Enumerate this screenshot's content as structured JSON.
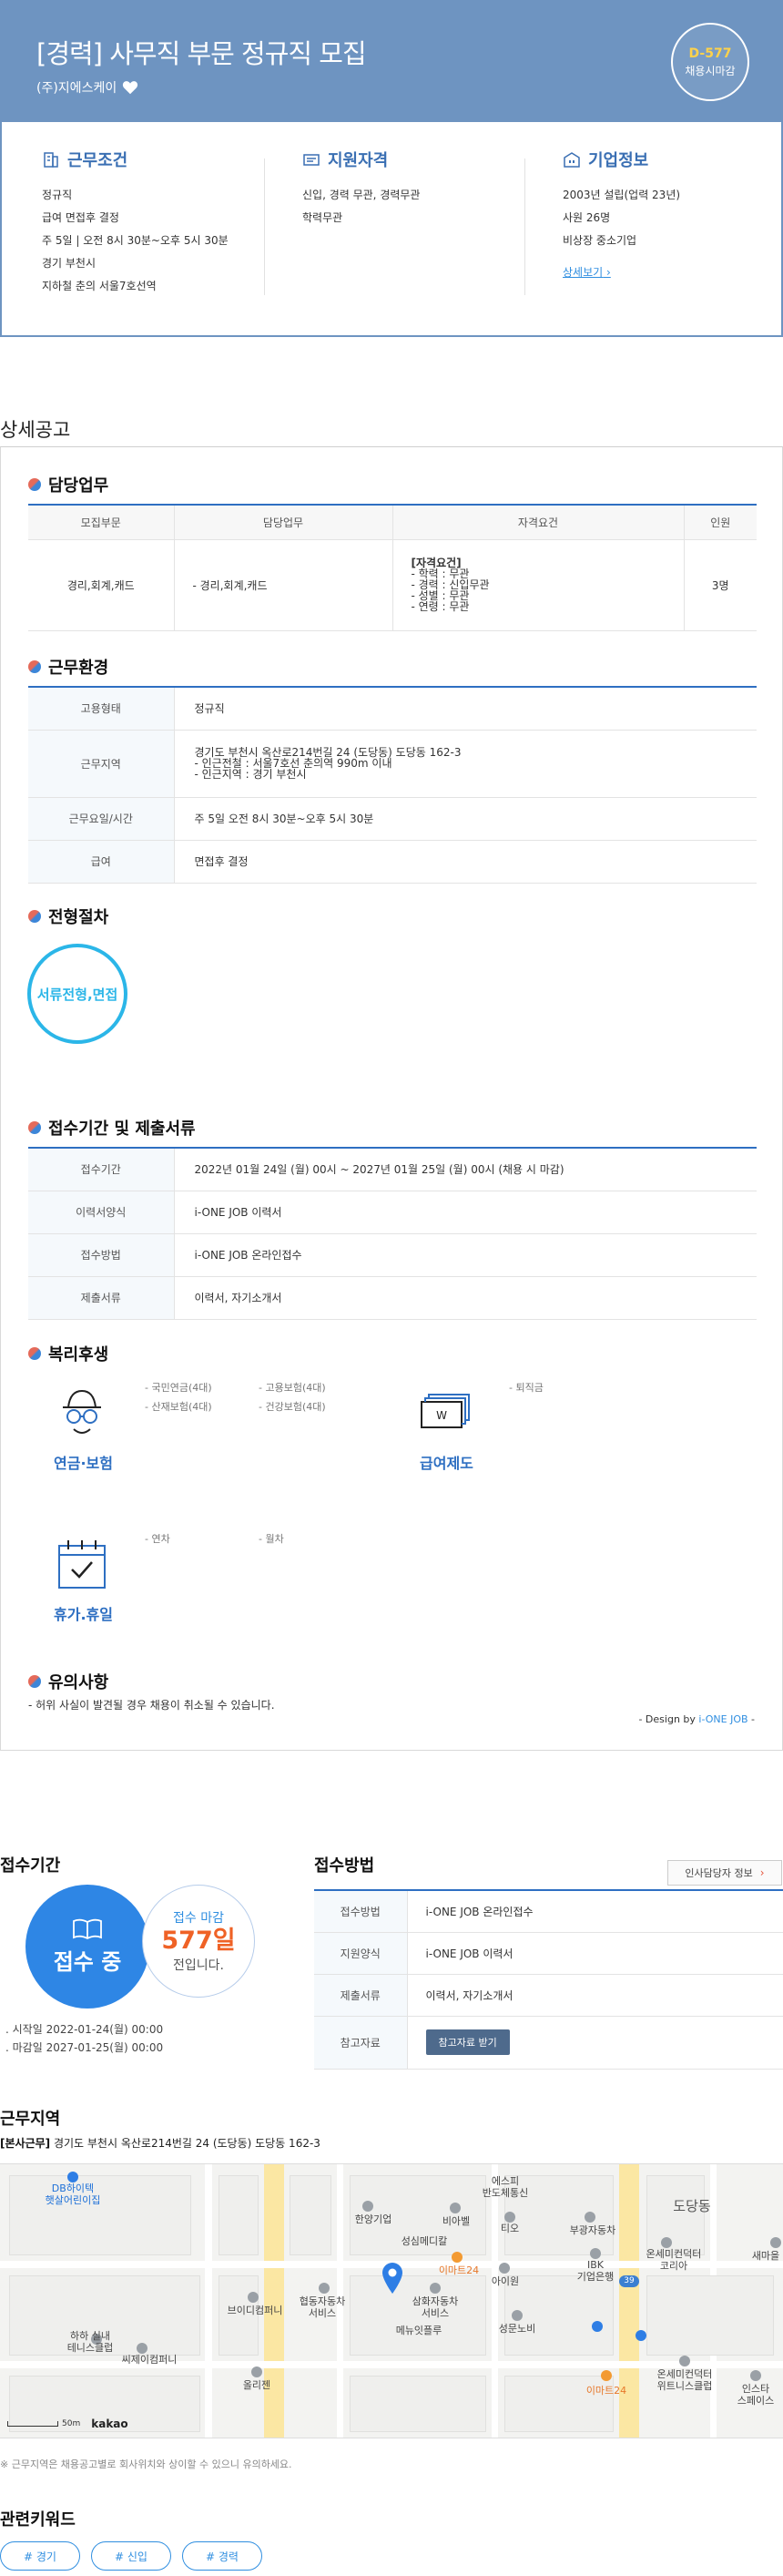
{
  "hero": {
    "title": "[경력] 사무직 부문 정규직 모집",
    "company": "(주)지에스케이",
    "dday": "D-577",
    "dday_label": "채용시마감"
  },
  "summary": {
    "work": {
      "title": "근무조건",
      "items": [
        "정규직",
        "급여 면접후 결정",
        "주 5일 | 오전 8시 30분~오후 5시 30분",
        "경기 부천시",
        "지하철 춘의 서울7호선역"
      ]
    },
    "qual": {
      "title": "지원자격",
      "items": [
        "신입, 경력 무관, 경력무관",
        "학력무관"
      ]
    },
    "corp": {
      "title": "기업정보",
      "items": [
        "2003년 설립(업력 23년)",
        "사원 26명",
        "비상장 중소기업"
      ],
      "link": "상세보기"
    }
  },
  "detail": {
    "title": "상세공고",
    "duty": {
      "title": "담당업무",
      "headers": [
        "모집부문",
        "담당업무",
        "자격요건",
        "인원"
      ],
      "row": {
        "dept": "경리,회계,캐드",
        "task": "- 경리,회계,캐드",
        "req_head": "[자격요건]",
        "req_lines": [
          "- 학력 : 무관",
          "- 경력 : 신입무관",
          "- 성별 : 무관",
          "- 연령 : 무관"
        ],
        "count": "3명"
      }
    },
    "env": {
      "title": "근무환경",
      "rows": [
        {
          "k": "고용형태",
          "v": [
            "정규직"
          ]
        },
        {
          "k": "근무지역",
          "v": [
            "경기도 부천시 옥산로214번길 24 (도당동) 도당동 162-3",
            "- 인근전철 : 서울7호선 춘의역 990m 이내",
            "- 인근지역 : 경기 부천시"
          ]
        },
        {
          "k": "근무요일/시간",
          "v": [
            "주 5일 오전 8시 30분~오후 5시 30분"
          ]
        },
        {
          "k": "급여",
          "v": [
            "면접후 결정"
          ]
        }
      ]
    },
    "process": {
      "title": "전형절차",
      "step": "서류전형,면접"
    },
    "period": {
      "title": "접수기간 및 제출서류",
      "rows": [
        {
          "k": "접수기간",
          "v": "2022년 01월 24일 (월) 00시 ~ 2027년 01월 25일 (월) 00시 (채용 시 마감)"
        },
        {
          "k": "이력서양식",
          "v": "i-ONE JOB 이력서"
        },
        {
          "k": "접수방법",
          "v": "i-ONE JOB 온라인접수"
        },
        {
          "k": "제출서류",
          "v": "이력서, 자기소개서"
        }
      ]
    },
    "welfare": {
      "title": "복리후생",
      "groups": [
        {
          "label": "연금·보험",
          "icon": "pension-glasses-icon",
          "items": [
            "- 국민연금(4대)",
            "- 고용보험(4대)",
            "- 산재보험(4대)",
            "- 건강보험(4대)"
          ]
        },
        {
          "label": "급여제도",
          "icon": "salary-bills-icon",
          "items": [
            "- 퇴직금"
          ]
        },
        {
          "label": "휴가.휴일",
          "icon": "calendar-check-icon",
          "items": [
            "- 연차",
            "- 월차"
          ]
        }
      ]
    },
    "caution": {
      "title": "유의사항",
      "text": "- 허위 사실이 발견될 경우 채용이 취소될 수 있습니다.",
      "design_prefix": "- Design by ",
      "design_brand": "i-ONE JOB",
      "design_suffix": " -"
    }
  },
  "apply": {
    "period_title": "접수기간",
    "status": "접수 중",
    "deadline_label": "접수 마감",
    "deadline_days": "577일",
    "deadline_suffix": "전입니다.",
    "start": ". 시작일 2022-01-24(월) 00:00",
    "end": ". 마감일 2027-01-25(월) 00:00",
    "method_title": "접수방법",
    "contact_btn": "인사담당자 정보",
    "rows": [
      {
        "k": "접수방법",
        "v": "i-ONE JOB 온라인접수"
      },
      {
        "k": "지원양식",
        "v": "i-ONE JOB 이력서"
      },
      {
        "k": "제출서류",
        "v": "이력서, 자기소개서"
      }
    ],
    "material_label": "참고자료",
    "material_btn": "참고자료 받기"
  },
  "location": {
    "title": "근무지역",
    "addr_head": "[본사근무]",
    "addr": " 경기도 부천시 옥산로214번길 24 (도당동) 도당동 162-3",
    "map_labels": {
      "db": "DB하이텍\n햇살어린이집",
      "hanyang": "한양기업",
      "bia": "비아벨",
      "esuki": "에스피\n반도체통신",
      "tio": "티오",
      "bugang": "부광자동차",
      "dodang": "도당동",
      "sungsim": "성심메디칼",
      "emart1": "이마트24",
      "ibk": "IBK\n기업은행",
      "onsemi": "온세미컨덕터\n코리아",
      "saema": "새마을",
      "aio": "아이원",
      "hyupdong": "협동자동차\n서비스",
      "samhwa": "삼화자동차\n서비스",
      "brydental": "브이디컴퍼니",
      "menu": "메뉴잇플루",
      "sungmun": "성문노비",
      "harmony": "하하 실내\n테니스클럽",
      "cmtennis": "씨제이컴퍼니",
      "olit": "올리젠",
      "emart2": "이마트24",
      "onsemi2": "온세미컨덕터\n위트니스클럽",
      "insta": "인스타\n스페이스",
      "road": "39"
    },
    "scale": "50m",
    "kakao": "kakao",
    "note": "※ 근무지역은 채용공고별로 회사위치와 상이할 수 있으니 유의하세요."
  },
  "keywords": {
    "title": "관련키워드",
    "items": [
      "# 경기",
      "# 신입",
      "# 경력"
    ]
  }
}
